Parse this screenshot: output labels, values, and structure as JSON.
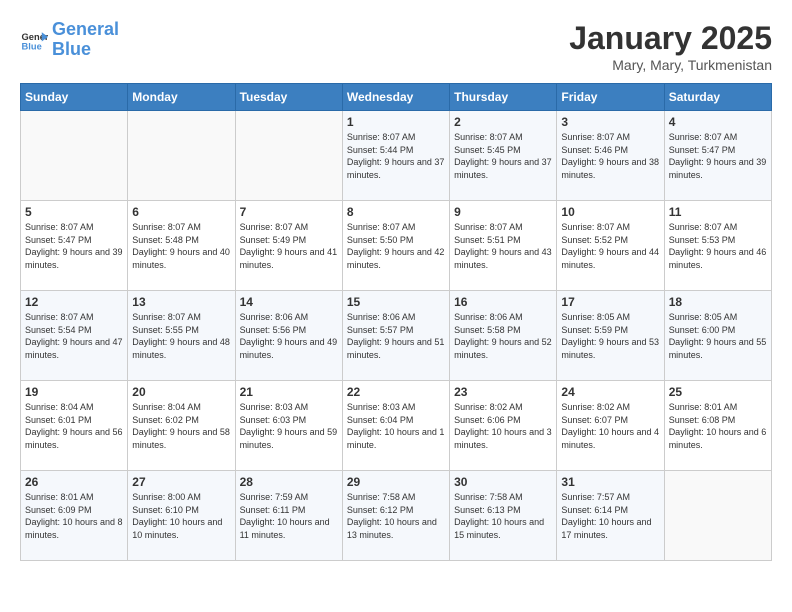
{
  "header": {
    "logo_line1": "General",
    "logo_line2": "Blue",
    "month": "January 2025",
    "location": "Mary, Mary, Turkmenistan"
  },
  "weekdays": [
    "Sunday",
    "Monday",
    "Tuesday",
    "Wednesday",
    "Thursday",
    "Friday",
    "Saturday"
  ],
  "weeks": [
    [
      {
        "day": "",
        "info": ""
      },
      {
        "day": "",
        "info": ""
      },
      {
        "day": "",
        "info": ""
      },
      {
        "day": "1",
        "info": "Sunrise: 8:07 AM\nSunset: 5:44 PM\nDaylight: 9 hours and 37 minutes."
      },
      {
        "day": "2",
        "info": "Sunrise: 8:07 AM\nSunset: 5:45 PM\nDaylight: 9 hours and 37 minutes."
      },
      {
        "day": "3",
        "info": "Sunrise: 8:07 AM\nSunset: 5:46 PM\nDaylight: 9 hours and 38 minutes."
      },
      {
        "day": "4",
        "info": "Sunrise: 8:07 AM\nSunset: 5:47 PM\nDaylight: 9 hours and 39 minutes."
      }
    ],
    [
      {
        "day": "5",
        "info": "Sunrise: 8:07 AM\nSunset: 5:47 PM\nDaylight: 9 hours and 39 minutes."
      },
      {
        "day": "6",
        "info": "Sunrise: 8:07 AM\nSunset: 5:48 PM\nDaylight: 9 hours and 40 minutes."
      },
      {
        "day": "7",
        "info": "Sunrise: 8:07 AM\nSunset: 5:49 PM\nDaylight: 9 hours and 41 minutes."
      },
      {
        "day": "8",
        "info": "Sunrise: 8:07 AM\nSunset: 5:50 PM\nDaylight: 9 hours and 42 minutes."
      },
      {
        "day": "9",
        "info": "Sunrise: 8:07 AM\nSunset: 5:51 PM\nDaylight: 9 hours and 43 minutes."
      },
      {
        "day": "10",
        "info": "Sunrise: 8:07 AM\nSunset: 5:52 PM\nDaylight: 9 hours and 44 minutes."
      },
      {
        "day": "11",
        "info": "Sunrise: 8:07 AM\nSunset: 5:53 PM\nDaylight: 9 hours and 46 minutes."
      }
    ],
    [
      {
        "day": "12",
        "info": "Sunrise: 8:07 AM\nSunset: 5:54 PM\nDaylight: 9 hours and 47 minutes."
      },
      {
        "day": "13",
        "info": "Sunrise: 8:07 AM\nSunset: 5:55 PM\nDaylight: 9 hours and 48 minutes."
      },
      {
        "day": "14",
        "info": "Sunrise: 8:06 AM\nSunset: 5:56 PM\nDaylight: 9 hours and 49 minutes."
      },
      {
        "day": "15",
        "info": "Sunrise: 8:06 AM\nSunset: 5:57 PM\nDaylight: 9 hours and 51 minutes."
      },
      {
        "day": "16",
        "info": "Sunrise: 8:06 AM\nSunset: 5:58 PM\nDaylight: 9 hours and 52 minutes."
      },
      {
        "day": "17",
        "info": "Sunrise: 8:05 AM\nSunset: 5:59 PM\nDaylight: 9 hours and 53 minutes."
      },
      {
        "day": "18",
        "info": "Sunrise: 8:05 AM\nSunset: 6:00 PM\nDaylight: 9 hours and 55 minutes."
      }
    ],
    [
      {
        "day": "19",
        "info": "Sunrise: 8:04 AM\nSunset: 6:01 PM\nDaylight: 9 hours and 56 minutes."
      },
      {
        "day": "20",
        "info": "Sunrise: 8:04 AM\nSunset: 6:02 PM\nDaylight: 9 hours and 58 minutes."
      },
      {
        "day": "21",
        "info": "Sunrise: 8:03 AM\nSunset: 6:03 PM\nDaylight: 9 hours and 59 minutes."
      },
      {
        "day": "22",
        "info": "Sunrise: 8:03 AM\nSunset: 6:04 PM\nDaylight: 10 hours and 1 minute."
      },
      {
        "day": "23",
        "info": "Sunrise: 8:02 AM\nSunset: 6:06 PM\nDaylight: 10 hours and 3 minutes."
      },
      {
        "day": "24",
        "info": "Sunrise: 8:02 AM\nSunset: 6:07 PM\nDaylight: 10 hours and 4 minutes."
      },
      {
        "day": "25",
        "info": "Sunrise: 8:01 AM\nSunset: 6:08 PM\nDaylight: 10 hours and 6 minutes."
      }
    ],
    [
      {
        "day": "26",
        "info": "Sunrise: 8:01 AM\nSunset: 6:09 PM\nDaylight: 10 hours and 8 minutes."
      },
      {
        "day": "27",
        "info": "Sunrise: 8:00 AM\nSunset: 6:10 PM\nDaylight: 10 hours and 10 minutes."
      },
      {
        "day": "28",
        "info": "Sunrise: 7:59 AM\nSunset: 6:11 PM\nDaylight: 10 hours and 11 minutes."
      },
      {
        "day": "29",
        "info": "Sunrise: 7:58 AM\nSunset: 6:12 PM\nDaylight: 10 hours and 13 minutes."
      },
      {
        "day": "30",
        "info": "Sunrise: 7:58 AM\nSunset: 6:13 PM\nDaylight: 10 hours and 15 minutes."
      },
      {
        "day": "31",
        "info": "Sunrise: 7:57 AM\nSunset: 6:14 PM\nDaylight: 10 hours and 17 minutes."
      },
      {
        "day": "",
        "info": ""
      }
    ]
  ]
}
